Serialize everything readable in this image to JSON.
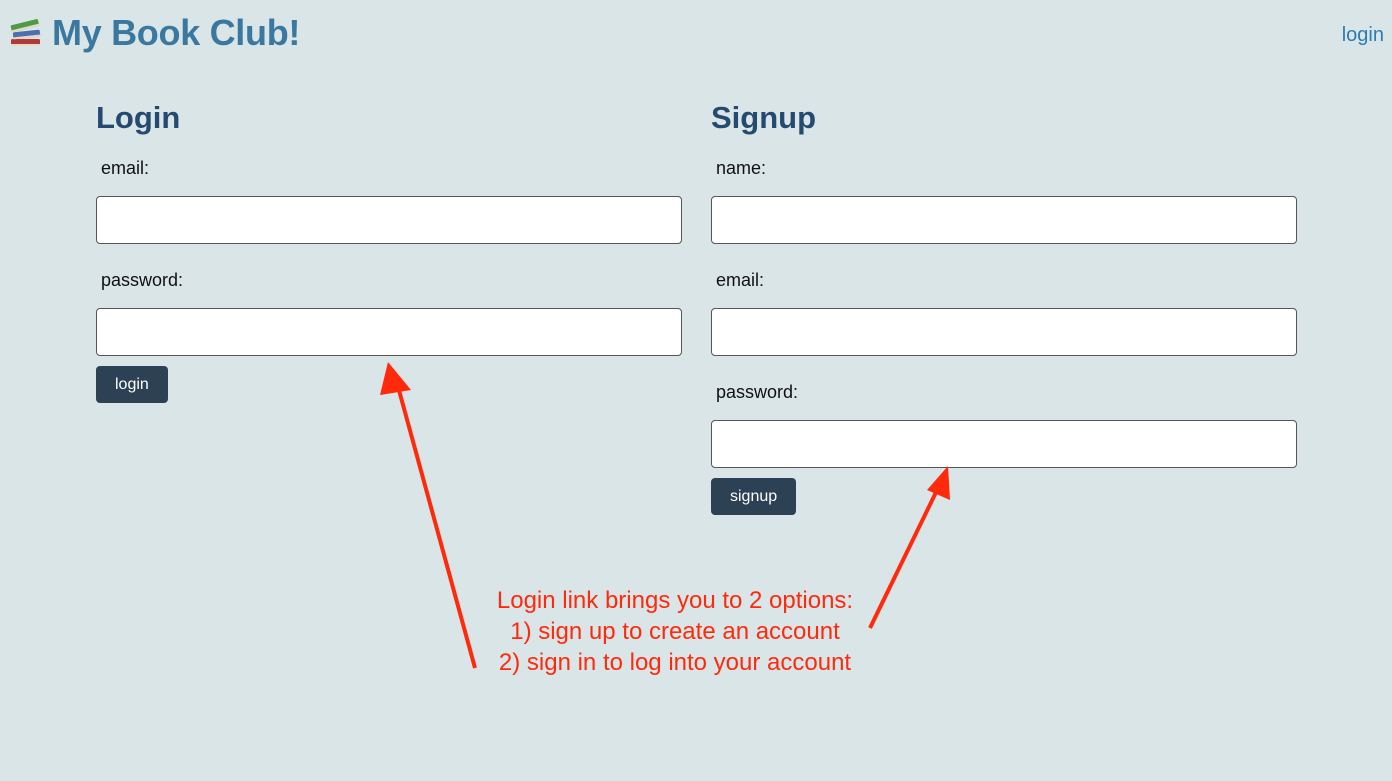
{
  "header": {
    "title": "My Book Club!",
    "login_link": "login"
  },
  "login_form": {
    "title": "Login",
    "email_label": "email:",
    "email_value": "",
    "password_label": "password:",
    "password_value": "",
    "submit_label": "login"
  },
  "signup_form": {
    "title": "Signup",
    "name_label": "name:",
    "name_value": "",
    "email_label": "email:",
    "email_value": "",
    "password_label": "password:",
    "password_value": "",
    "submit_label": "signup"
  },
  "annotation": {
    "lines": [
      "Login link brings you to 2 options:",
      "1) sign up to create an account",
      "2) sign in to log into your account"
    ],
    "color": "#ff2a0c"
  },
  "colors": {
    "background": "#dae5e8",
    "brand": "#3a789f",
    "heading": "#254a70",
    "button": "#2c4154",
    "link": "#2f7bb3"
  }
}
